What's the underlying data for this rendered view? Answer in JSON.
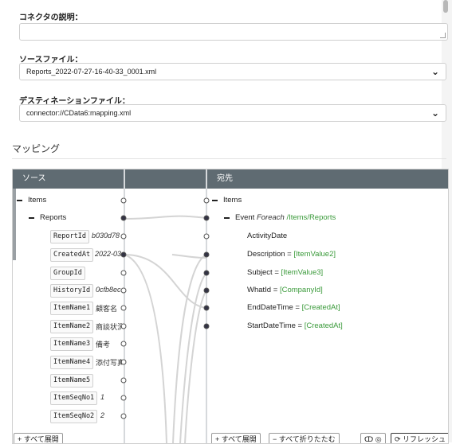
{
  "form": {
    "description_label": "コネクタの説明：",
    "description_value": "",
    "source_file_label": "ソースファイル：",
    "source_file_value": "Reports_2022-07-27-16-40-33_0001.xml",
    "dest_file_label": "デスティネーションファイル：",
    "dest_file_value": "connector://CData6:mapping.xml"
  },
  "mapping": {
    "title": "マッピング",
    "source_header": "ソース",
    "dest_header": "宛先",
    "source": {
      "root": "Items",
      "child": "Reports",
      "fields": [
        {
          "name": "ReportId",
          "value": "b030d78"
        },
        {
          "name": "CreatedAt",
          "value": "2022-03"
        },
        {
          "name": "GroupId",
          "value": ""
        },
        {
          "name": "HistoryId",
          "value": "0cfb8ec"
        },
        {
          "name": "ItemName1",
          "value": "顧客名"
        },
        {
          "name": "ItemName2",
          "value": "商談状況"
        },
        {
          "name": "ItemName3",
          "value": "備考"
        },
        {
          "name": "ItemName4",
          "value": "添付写真"
        },
        {
          "name": "ItemName5",
          "value": ""
        },
        {
          "name": "ItemSeqNo1",
          "value": "1"
        },
        {
          "name": "ItemSeqNo2",
          "value": "2"
        }
      ]
    },
    "dest": {
      "root": "Items",
      "event_label": "Event",
      "foreach_label": "Foreach",
      "foreach_path": "/Items/Reports",
      "fields": [
        {
          "name": "ActivityDate",
          "eq": "",
          "value": ""
        },
        {
          "name": "Description",
          "eq": "=",
          "value": "[ItemValue2]"
        },
        {
          "name": "Subject",
          "eq": "=",
          "value": "[ItemValue3]"
        },
        {
          "name": "WhatId",
          "eq": "=",
          "value": "[CompanyId]"
        },
        {
          "name": "EndDateTime",
          "eq": "=",
          "value": "[CreatedAt]"
        },
        {
          "name": "StartDateTime",
          "eq": "=",
          "value": "[CreatedAt]"
        }
      ]
    },
    "buttons": {
      "source_expand": "+ すべて展開",
      "dest_expand": "+ すべて展開",
      "dest_collapse": "− すべて折りたたむ",
      "link_toggle": "ↀ ◎",
      "refresh": "⟳ リフレッシュ"
    }
  }
}
